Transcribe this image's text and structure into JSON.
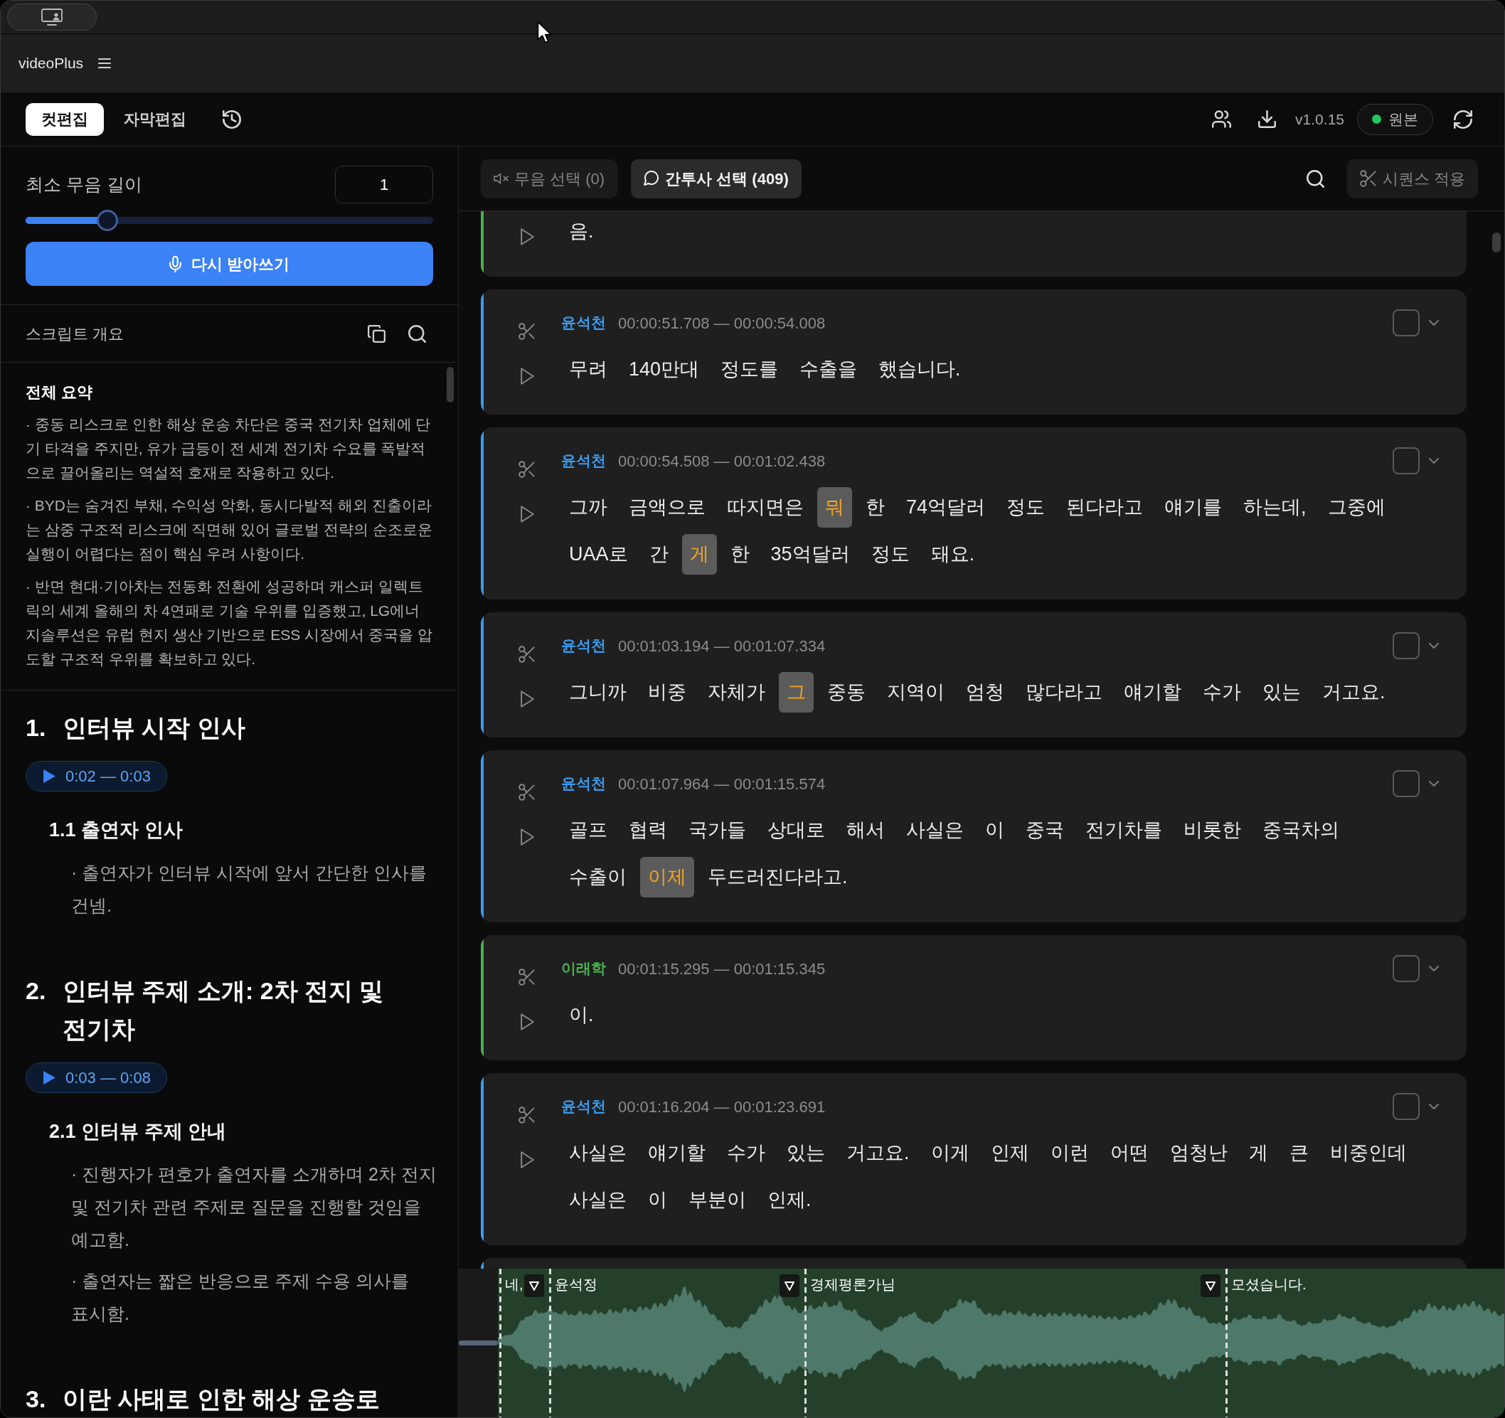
{
  "app": {
    "name": "videoPlus"
  },
  "toolbar": {
    "tabs": [
      {
        "label": "컷편집",
        "selected": true
      },
      {
        "label": "자막편집",
        "selected": false
      }
    ],
    "version": "v1.0.15",
    "source": "원본"
  },
  "silence": {
    "label": "최소 무음 길이",
    "value": "1",
    "level": 0.2,
    "button": "다시 받아쓰기"
  },
  "overview": {
    "title": "스크립트 개요",
    "summary_title": "전체 요약",
    "summary": [
      "· 중동 리스크로 인한 해상 운송 차단은 중국 전기차 업체에 단기 타격을 주지만, 유가 급등이 전 세계 전기차 수요를 폭발적으로 끌어올리는 역설적 호재로 작용하고 있다.",
      "· BYD는 숨겨진 부채, 수익성 악화, 동시다발적 해외 진출이라는 삼중 구조적 리스크에 직면해 있어 글로벌 전략의 순조로운 실행이 어렵다는 점이 핵심 우려 사항이다.",
      "· 반면 현대·기아차는 전동화 전환에 성공하며 캐스퍼 일렉트릭의 세계 올해의 차 4연패로 기술 우위를 입증했고, LG에너지솔루션은 유럽 현지 생산 기반으로 ESS 시장에서 중국을 압도할 구조적 우위를 확보하고 있다."
    ],
    "sections": [
      {
        "number": "1.",
        "title": "인터뷰 시작 인사",
        "time": "0:02 — 0:03",
        "subsections": [
          {
            "title": "1.1 출연자 인사",
            "bullets": [
              "· 출연자가 인터뷰 시작에 앞서 간단한 인사를 건넴."
            ]
          }
        ]
      },
      {
        "number": "2.",
        "title": "인터뷰 주제 소개: 2차 전지 및 전기차",
        "time": "0:03 — 0:08",
        "subsections": [
          {
            "title": "2.1 인터뷰 주제 안내",
            "bullets": [
              "· 진행자가 편호가 출연자를 소개하며 2차 전지 및 전기차 관련 주제로 질문을 진행할 것임을 예고함.",
              "· 출연자는 짧은 반응으로 주제 수용 의사를 표시함."
            ]
          }
        ]
      },
      {
        "number": "3.",
        "title": "이란 사태로 인한 해상 운송로"
      }
    ]
  },
  "editor": {
    "buttons": [
      {
        "kind": "silence",
        "label": "무음 선택 (0)",
        "disabled": true
      },
      {
        "kind": "filler",
        "label": "간투사 선택 (409)",
        "disabled": false
      }
    ],
    "apply": {
      "label": "시퀀스 적용",
      "disabled": true
    }
  },
  "segments": [
    {
      "color": "#4caf50",
      "lines": [
        [
          {
            "text": "음.",
            "filler": false
          }
        ]
      ]
    },
    {
      "speaker": "윤석천",
      "color": "#3b9cf0",
      "time": "00:00:51.708 — 00:00:54.008",
      "checked": false,
      "lines": [
        [
          {
            "text": "무려",
            "filler": false
          },
          {
            "text": "140만대",
            "filler": false
          },
          {
            "text": "정도를",
            "filler": false
          },
          {
            "text": "수출을",
            "filler": false
          },
          {
            "text": "했습니다.",
            "filler": false
          }
        ]
      ]
    },
    {
      "speaker": "윤석천",
      "color": "#3b9cf0",
      "time": "00:00:54.508 — 00:01:02.438",
      "checked": false,
      "lines": [
        [
          {
            "text": "그까",
            "filler": false
          },
          {
            "text": "금액으로",
            "filler": false
          },
          {
            "text": "따지면은",
            "filler": false
          },
          {
            "text": "뭐",
            "filler": true
          },
          {
            "text": "한",
            "filler": false
          },
          {
            "text": "74억달러",
            "filler": false
          },
          {
            "text": "정도",
            "filler": false
          },
          {
            "text": "된다라고",
            "filler": false
          },
          {
            "text": "얘기를",
            "filler": false
          },
          {
            "text": "하는데,",
            "filler": false
          },
          {
            "text": "그중에",
            "filler": false
          }
        ],
        [
          {
            "text": "UAA로",
            "filler": false
          },
          {
            "text": "간",
            "filler": false
          },
          {
            "text": "게",
            "filler": true
          },
          {
            "text": "한",
            "filler": false
          },
          {
            "text": "35억달러",
            "filler": false
          },
          {
            "text": "정도",
            "filler": false
          },
          {
            "text": "돼요.",
            "filler": false
          }
        ]
      ]
    },
    {
      "speaker": "윤석천",
      "color": "#3b9cf0",
      "time": "00:01:03.194 — 00:01:07.334",
      "checked": false,
      "lines": [
        [
          {
            "text": "그니까",
            "filler": false
          },
          {
            "text": "비중",
            "filler": false
          },
          {
            "text": "자체가",
            "filler": false
          },
          {
            "text": "그",
            "filler": true
          },
          {
            "text": "중동",
            "filler": false
          },
          {
            "text": "지역이",
            "filler": false
          },
          {
            "text": "엄청",
            "filler": false
          },
          {
            "text": "많다라고",
            "filler": false
          },
          {
            "text": "얘기할",
            "filler": false
          },
          {
            "text": "수가",
            "filler": false
          },
          {
            "text": "있는",
            "filler": false
          },
          {
            "text": "거고요.",
            "filler": false
          }
        ]
      ]
    },
    {
      "speaker": "윤석천",
      "color": "#3b9cf0",
      "time": "00:01:07.964 — 00:01:15.574",
      "checked": false,
      "lines": [
        [
          {
            "text": "골프",
            "filler": false
          },
          {
            "text": "협력",
            "filler": false
          },
          {
            "text": "국가들",
            "filler": false
          },
          {
            "text": "상대로",
            "filler": false
          },
          {
            "text": "해서",
            "filler": false
          },
          {
            "text": "사실은",
            "filler": false
          },
          {
            "text": "이",
            "filler": false
          },
          {
            "text": "중국",
            "filler": false
          },
          {
            "text": "전기차를",
            "filler": false
          },
          {
            "text": "비롯한",
            "filler": false
          },
          {
            "text": "중국차의",
            "filler": false
          }
        ],
        [
          {
            "text": "수출이",
            "filler": false
          },
          {
            "text": "이제",
            "filler": true
          },
          {
            "text": "두드러진다라고.",
            "filler": false
          }
        ]
      ]
    },
    {
      "speaker": "이래학",
      "color": "#4caf50",
      "time": "00:01:15.295 — 00:01:15.345",
      "checked": false,
      "lines": [
        [
          {
            "text": "이.",
            "filler": false
          }
        ]
      ]
    },
    {
      "speaker": "윤석천",
      "color": "#3b9cf0",
      "time": "00:01:16.204 — 00:01:23.691",
      "checked": false,
      "lines": [
        [
          {
            "text": "사실은",
            "filler": false
          },
          {
            "text": "얘기할",
            "filler": false
          },
          {
            "text": "수가",
            "filler": false
          },
          {
            "text": "있는",
            "filler": false
          },
          {
            "text": "거고요.",
            "filler": false
          },
          {
            "text": "이게",
            "filler": false
          },
          {
            "text": "인제",
            "filler": false
          },
          {
            "text": "이런",
            "filler": false
          },
          {
            "text": "어떤",
            "filler": false
          },
          {
            "text": "엄청난",
            "filler": false
          },
          {
            "text": "게",
            "filler": false
          },
          {
            "text": "큰",
            "filler": false
          },
          {
            "text": "비중인데",
            "filler": false
          }
        ],
        [
          {
            "text": "사실은",
            "filler": false
          },
          {
            "text": "이",
            "filler": false
          },
          {
            "text": "부분이",
            "filler": false
          },
          {
            "text": "인제.",
            "filler": false
          }
        ]
      ]
    },
    {
      "color": "#3b9cf0"
    }
  ],
  "waveform": {
    "clips": [
      {
        "label": "네,",
        "marker": true
      },
      {
        "label": "윤석정",
        "marker": true
      },
      {
        "label": "경제평론가님",
        "marker": true
      },
      {
        "label": "모셨습니다.",
        "marker": false
      }
    ]
  }
}
